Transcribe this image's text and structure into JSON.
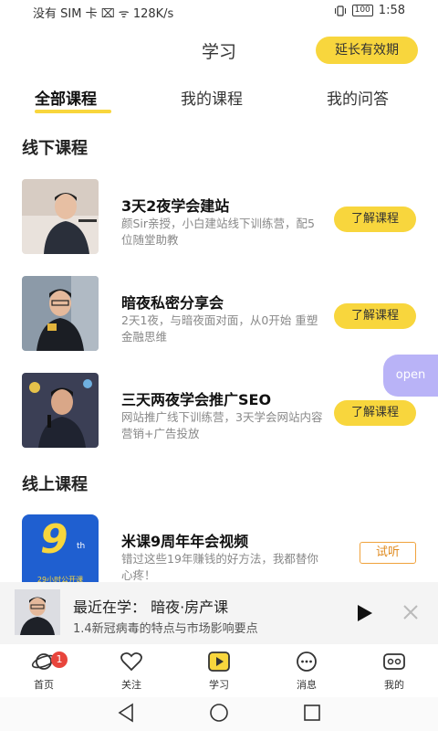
{
  "status_bar": {
    "left": "没有 SIM 卡 ⌧ ᯤ 128K/s",
    "battery": "100",
    "time": "1:58"
  },
  "header": {
    "title": "学习",
    "extend_label": "延长有效期"
  },
  "tabs": [
    {
      "label": "全部课程",
      "active": true
    },
    {
      "label": "我的课程",
      "active": false
    },
    {
      "label": "我的问答",
      "active": false
    }
  ],
  "offline": {
    "title": "线下课程",
    "courses": [
      {
        "title": "3天2夜学会建站",
        "desc": "颜Sir亲授，小白建站线下训练营，配5位随堂助教",
        "action": "了解课程"
      },
      {
        "title": "暗夜私密分享会",
        "desc": "2天1夜，与暗夜面对面，从0开始 重塑金融思维",
        "action": "了解课程"
      },
      {
        "title": "三天两夜学会推广SEO",
        "desc": "网站推广线下训练营，3天学会网站内容营销+广告投放",
        "action": "了解课程"
      }
    ]
  },
  "online": {
    "title": "线上课程",
    "courses": [
      {
        "title": "米课9周年年会视频",
        "desc": "错过这些19年赚钱的好方法，我都替你心疼！",
        "action": "试听",
        "thumb_big": "9",
        "thumb_sup": "th",
        "thumb_text": "29小时公开课"
      }
    ]
  },
  "open_float": "open",
  "recent": {
    "title": "最近在学： 暗夜·房产课",
    "subtitle": "1.4新冠病毒的特点与市场影响要点"
  },
  "tabbar": [
    {
      "label": "首页",
      "icon": "planet-icon",
      "badge": "1"
    },
    {
      "label": "关注",
      "icon": "heart-icon"
    },
    {
      "label": "学习",
      "icon": "play-square-icon"
    },
    {
      "label": "消息",
      "icon": "chat-icon"
    },
    {
      "label": "我的",
      "icon": "profile-icon"
    }
  ],
  "colors": {
    "accent": "#f8d63d",
    "trial": "#f0a23c",
    "badge": "#e8453c",
    "float": "#b9b3f7"
  }
}
